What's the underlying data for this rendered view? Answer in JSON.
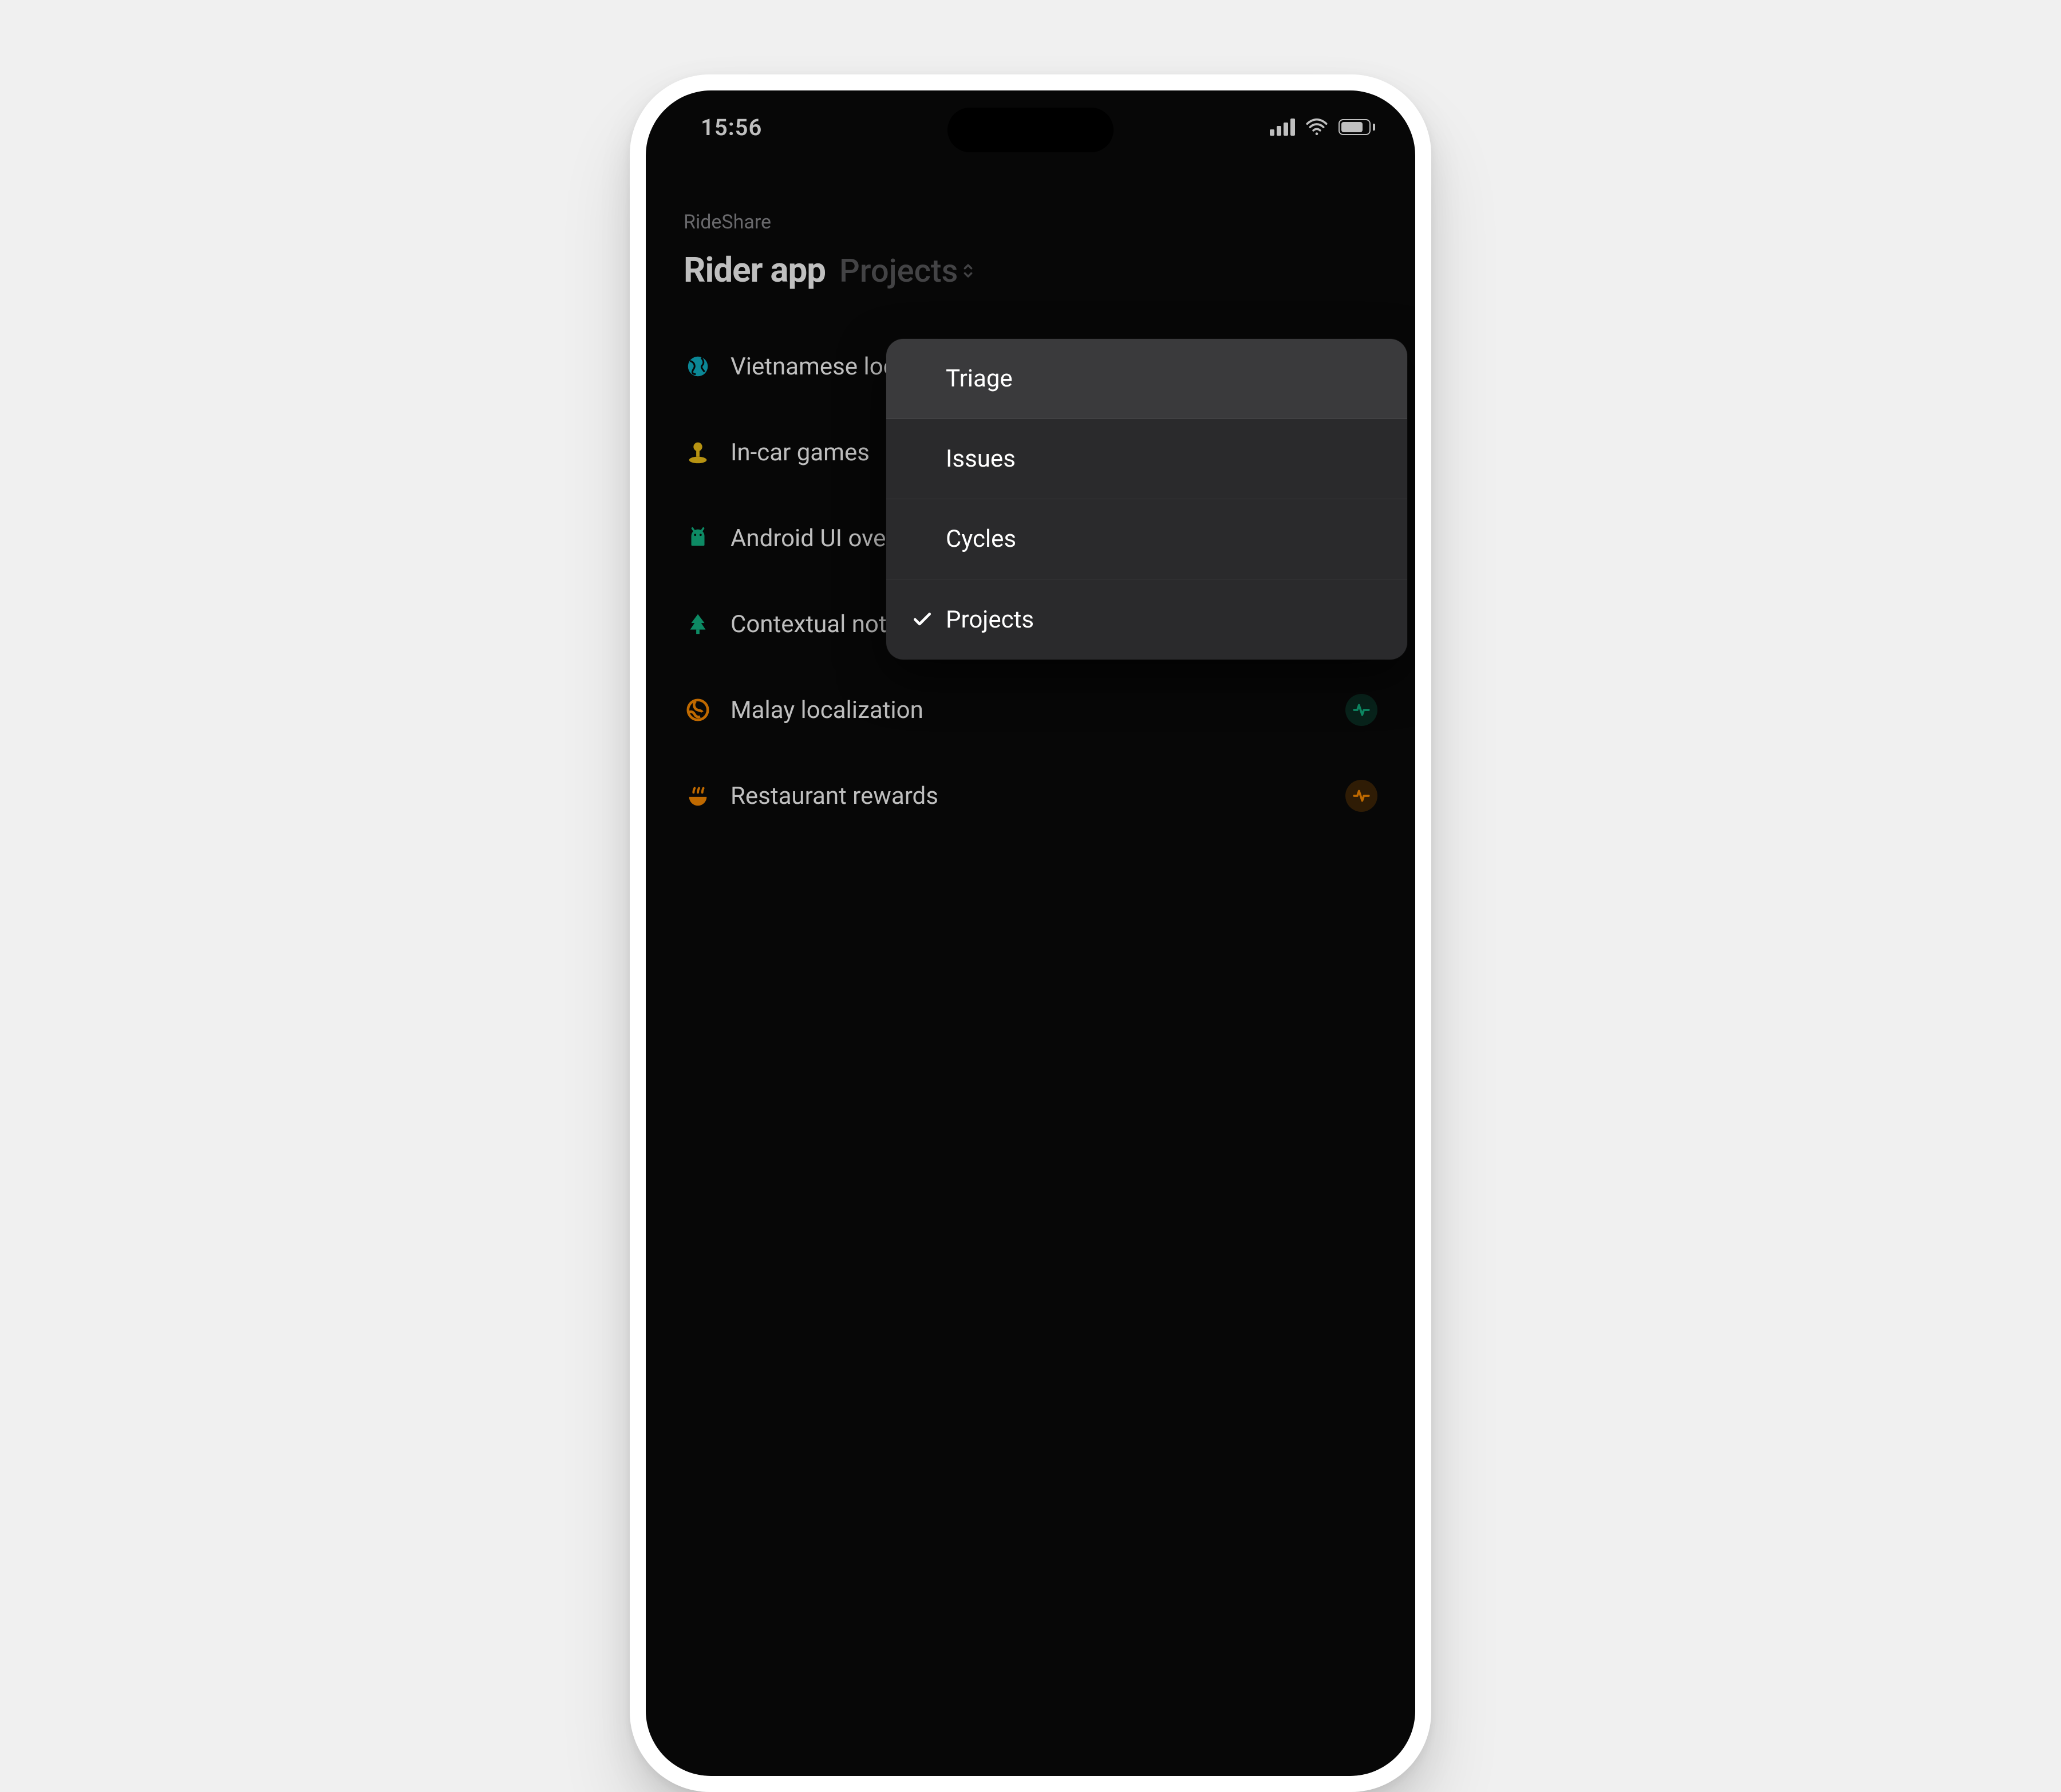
{
  "status": {
    "time": "15:56"
  },
  "breadcrumb": "RideShare",
  "title": "Rider app",
  "viewSwitcher": {
    "label": "Projects"
  },
  "colors": {
    "teal": "#0fb5c9",
    "yellow": "#f5c518",
    "green": "#12b886",
    "orange": "#ff8c00",
    "gray": "#9a9a9e"
  },
  "projects": [
    {
      "icon": "globe",
      "iconColor": "teal",
      "label": "Vietnamese localization",
      "status": "green"
    },
    {
      "icon": "joystick",
      "iconColor": "yellow",
      "label": "In-car games",
      "status": "orange"
    },
    {
      "icon": "android",
      "iconColor": "green",
      "label": "Android UI overhaul",
      "status": "green"
    },
    {
      "icon": "tree",
      "iconColor": "green",
      "label": "Contextual notifications",
      "status": "dashed"
    },
    {
      "icon": "globe-alt",
      "iconColor": "orange",
      "label": "Malay localization",
      "status": "green"
    },
    {
      "icon": "bowl",
      "iconColor": "orange",
      "label": "Restaurant rewards",
      "status": "orange"
    }
  ],
  "menu": {
    "items": [
      {
        "label": "Triage",
        "highlighted": true,
        "selected": false
      },
      {
        "label": "Issues",
        "highlighted": false,
        "selected": false
      },
      {
        "label": "Cycles",
        "highlighted": false,
        "selected": false
      },
      {
        "label": "Projects",
        "highlighted": false,
        "selected": true
      }
    ]
  }
}
